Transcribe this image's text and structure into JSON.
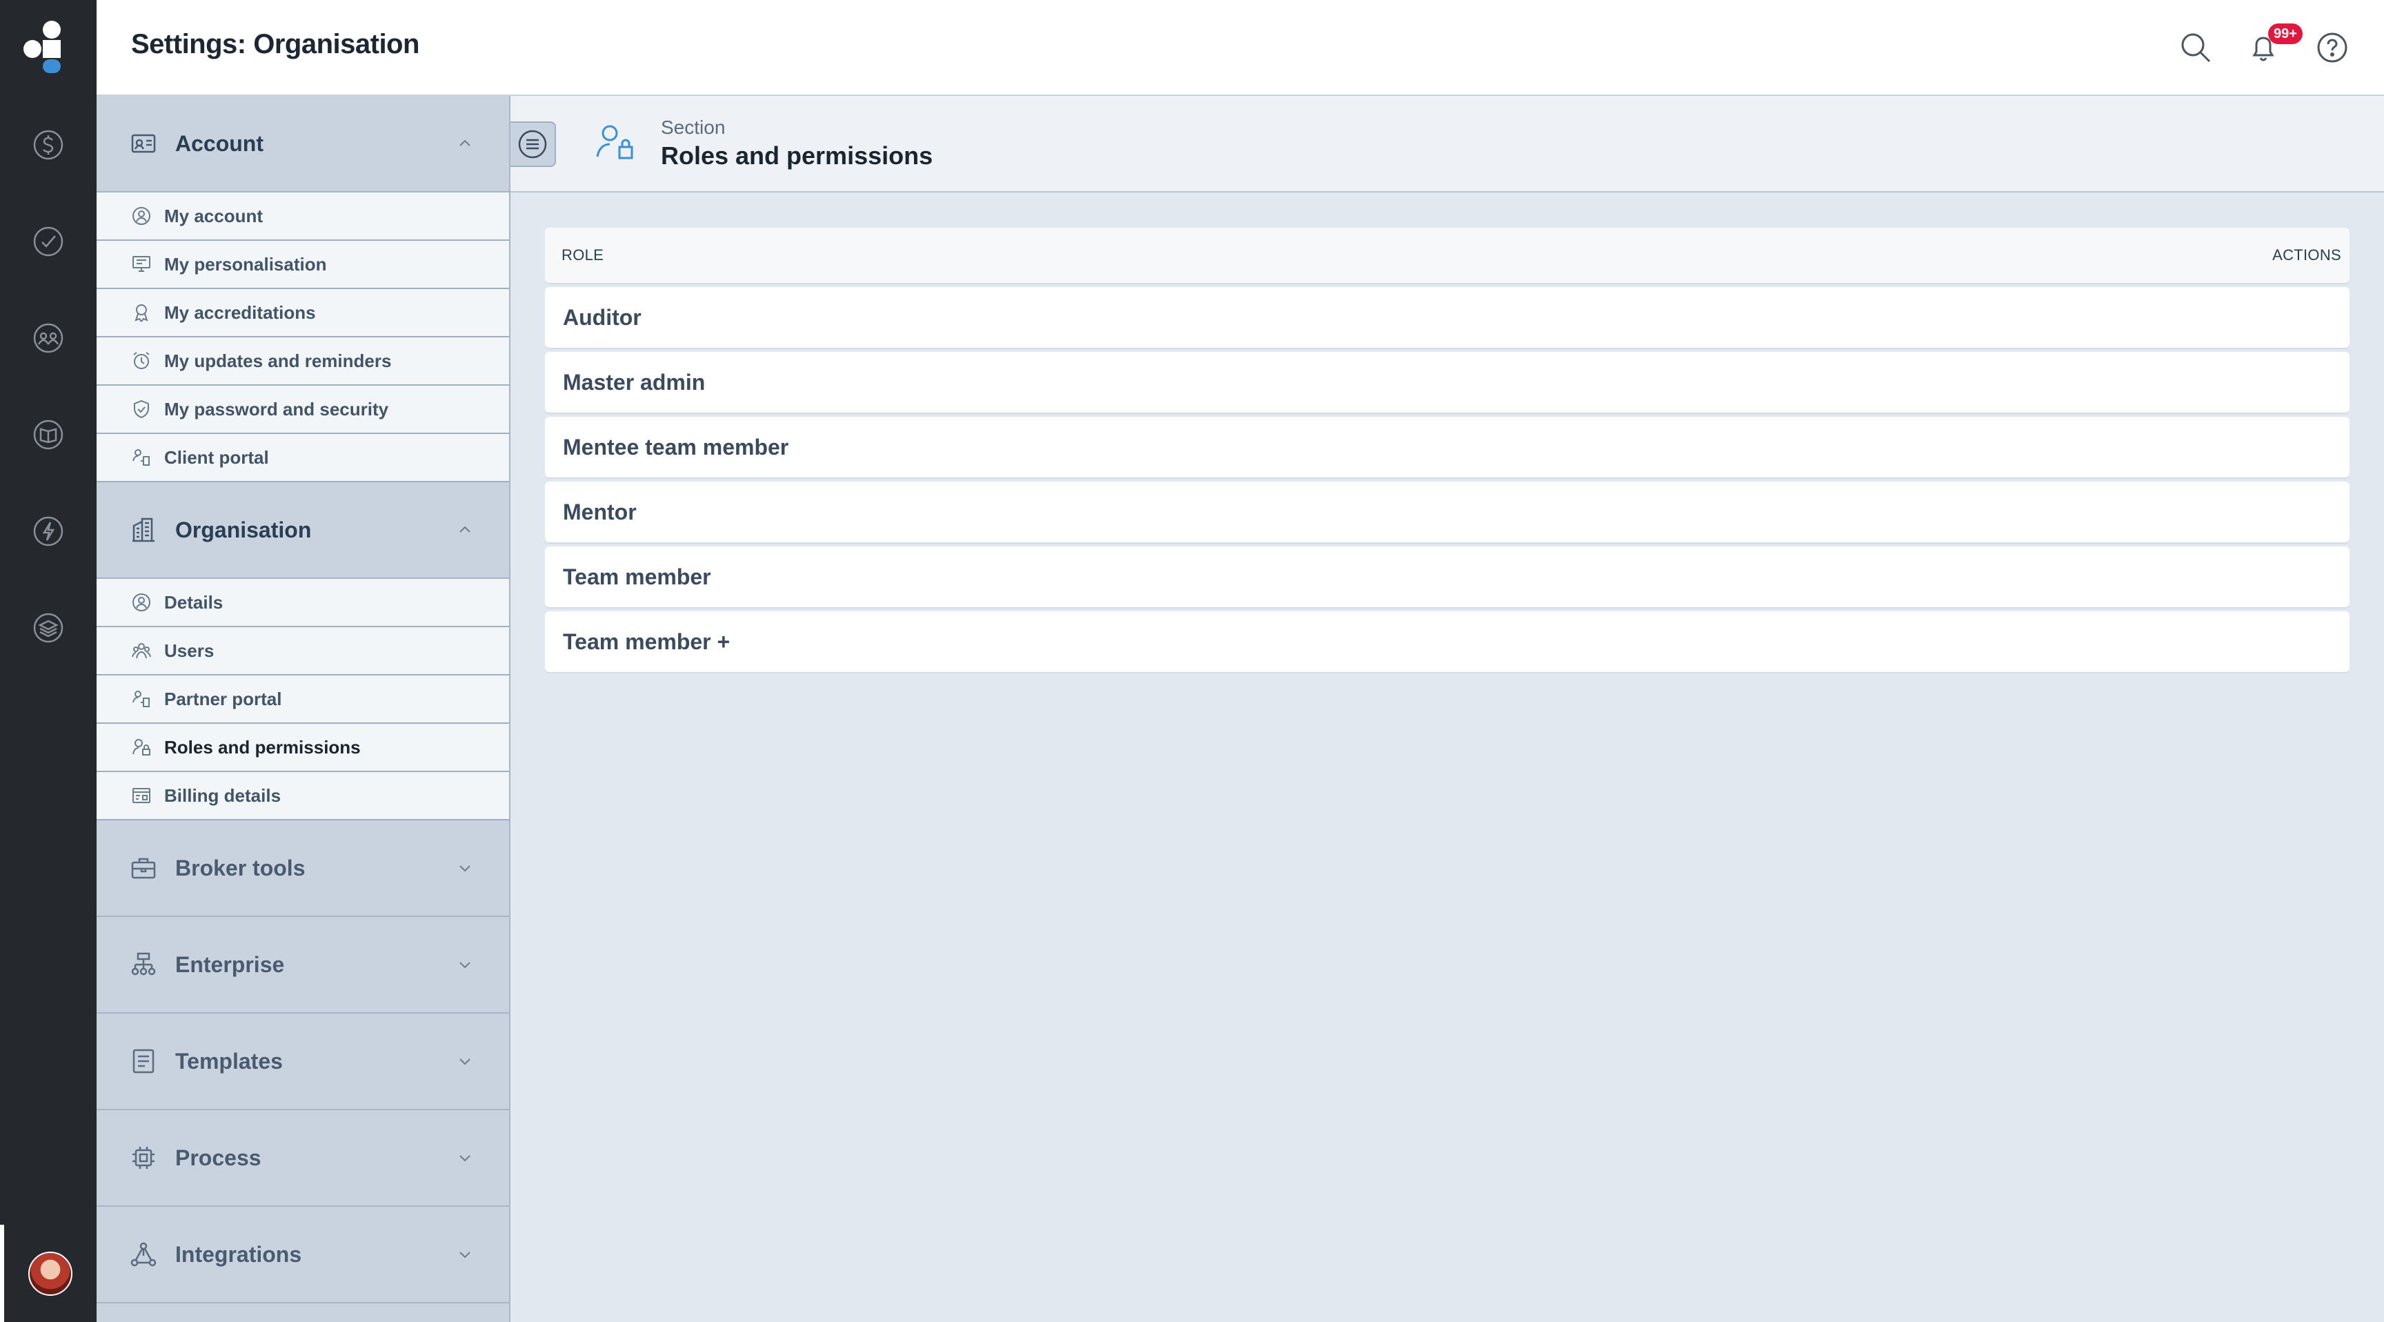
{
  "app": {
    "page_title": "Settings: Organisation",
    "notification_badge": "99+"
  },
  "rail": {
    "icons": [
      "logo-icon",
      "dollar-icon",
      "check-circle-icon",
      "people-icon",
      "book-icon",
      "lightning-icon",
      "layers-icon"
    ]
  },
  "menu": {
    "groups": [
      {
        "label": "Account",
        "icon": "id-card-icon",
        "expanded": true,
        "items": [
          {
            "label": "My account",
            "icon": "user-circle-icon"
          },
          {
            "label": "My personalisation",
            "icon": "monitor-icon"
          },
          {
            "label": "My accreditations",
            "icon": "award-icon"
          },
          {
            "label": "My updates and reminders",
            "icon": "alarm-icon"
          },
          {
            "label": "My password and security",
            "icon": "shield-icon"
          },
          {
            "label": "Client portal",
            "icon": "portal-icon"
          }
        ]
      },
      {
        "label": "Organisation",
        "icon": "building-icon",
        "expanded": true,
        "items": [
          {
            "label": "Details",
            "icon": "user-circle-icon"
          },
          {
            "label": "Users",
            "icon": "users-icon"
          },
          {
            "label": "Partner portal",
            "icon": "portal-icon"
          },
          {
            "label": "Roles and permissions",
            "icon": "user-lock-icon",
            "active": true
          },
          {
            "label": "Billing details",
            "icon": "billing-icon"
          }
        ]
      },
      {
        "label": "Broker tools",
        "icon": "briefcase-icon",
        "expanded": false
      },
      {
        "label": "Enterprise",
        "icon": "hierarchy-icon",
        "expanded": false
      },
      {
        "label": "Templates",
        "icon": "document-icon",
        "expanded": false
      },
      {
        "label": "Process",
        "icon": "chip-icon",
        "expanded": false
      },
      {
        "label": "Integrations",
        "icon": "network-icon",
        "expanded": false
      }
    ]
  },
  "section": {
    "kicker": "Section",
    "title": "Roles and permissions",
    "icon": "user-lock-icon"
  },
  "roles_table": {
    "col_role": "ROLE",
    "col_actions": "ACTIONS",
    "rows": [
      "Auditor",
      "Master admin",
      "Mentee team member",
      "Mentor",
      "Team member",
      "Team member +"
    ]
  },
  "colors": {
    "rail_bg": "#25282c",
    "menu_bg": "#c8d3df",
    "content_bg": "#e1e8f0",
    "accent": "#3a8fd6",
    "badge": "#e3173e"
  }
}
